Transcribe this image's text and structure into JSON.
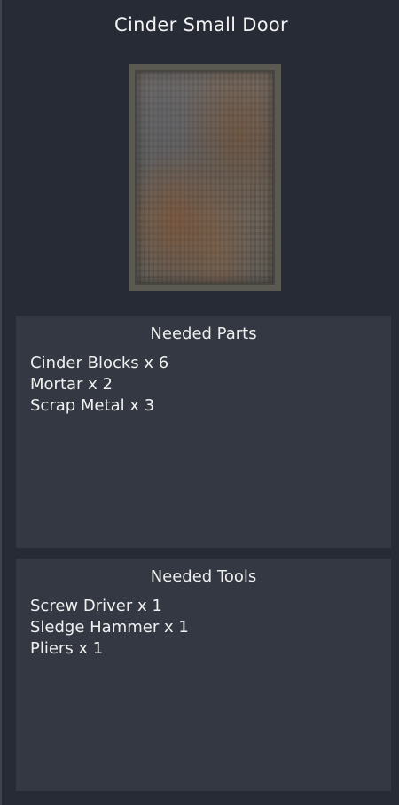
{
  "item": {
    "title": "Cinder Small Door",
    "image_name": "cinder-small-door-image"
  },
  "parts": {
    "heading": "Needed Parts",
    "items": [
      "Cinder Blocks x 6",
      "Mortar x 2",
      "Scrap Metal x 3"
    ]
  },
  "tools": {
    "heading": "Needed Tools",
    "items": [
      "Screw Driver x 1",
      "Sledge Hammer x 1",
      "Pliers x 1"
    ]
  }
}
